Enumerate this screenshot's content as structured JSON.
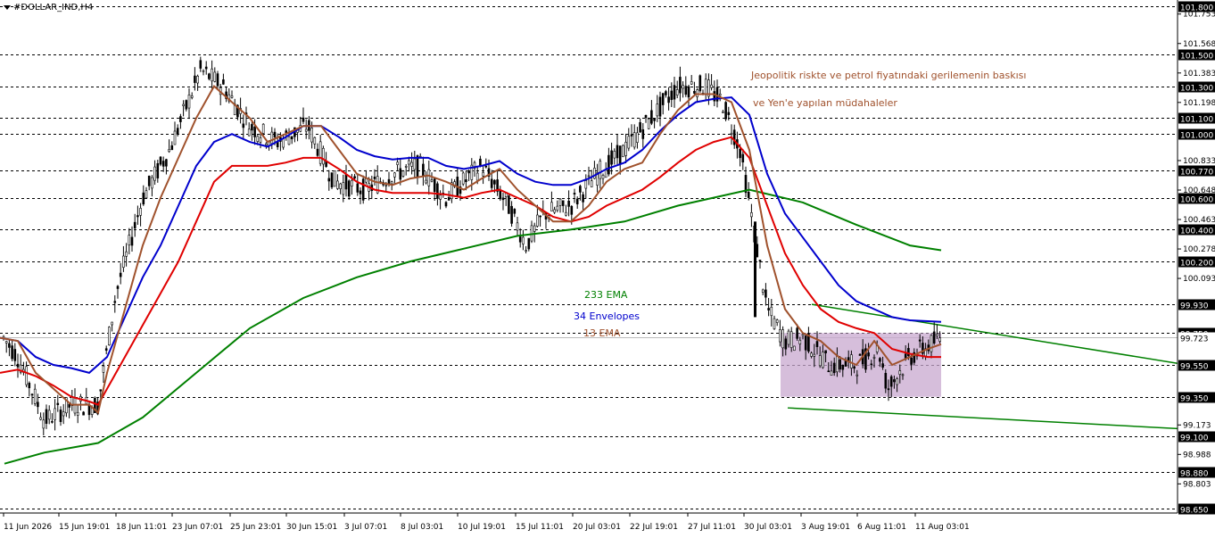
{
  "chart_data": {
    "type": "candlestick",
    "symbol": "#DOLLAR_IND,H4",
    "ylim": [
      98.62,
      101.83
    ],
    "y_ticks": [
      "101.753",
      "101.568",
      "101.383",
      "101.198",
      "100.833",
      "100.648",
      "100.463",
      "100.278",
      "100.093",
      "99.173",
      "98.988",
      "98.803"
    ],
    "level_lines": [
      {
        "value": 101.8,
        "label": "101.800"
      },
      {
        "value": 101.5,
        "label": "101.500"
      },
      {
        "value": 101.3,
        "label": "101.300"
      },
      {
        "value": 101.1,
        "label": "101.100"
      },
      {
        "value": 101.0,
        "label": "101.000"
      },
      {
        "value": 100.77,
        "label": "100.770"
      },
      {
        "value": 100.6,
        "label": "100.600"
      },
      {
        "value": 100.4,
        "label": "100.400"
      },
      {
        "value": 100.2,
        "label": "100.200"
      },
      {
        "value": 99.93,
        "label": "99.930"
      },
      {
        "value": 99.75,
        "label": "99.750"
      },
      {
        "value": 99.55,
        "label": "99.550"
      },
      {
        "value": 99.35,
        "label": "99.350"
      },
      {
        "value": 99.1,
        "label": "99.100"
      },
      {
        "value": 98.88,
        "label": "98.880"
      },
      {
        "value": 98.65,
        "label": "98.650"
      }
    ],
    "current_price": {
      "value": 99.723,
      "label": "99.723"
    },
    "x_ticks": [
      "11 Jun 2026",
      "15 Jun 19:01",
      "18 Jun 11:01",
      "23 Jun 07:01",
      "25 Jun 23:01",
      "30 Jun 15:01",
      "3 Jul 07:01",
      "8 Jul 03:01",
      "10 Jul 19:01",
      "15 Jul 11:01",
      "20 Jul 03:01",
      "22 Jul 19:01",
      "27 Jul 11:01",
      "30 Jul 03:01",
      "3 Aug 19:01",
      "6 Aug 11:01",
      "11 Aug 03:01"
    ],
    "indicators": [
      {
        "name": "233 EMA",
        "color": "#008000"
      },
      {
        "name": "34 Envelopes",
        "color": "#0000cd"
      },
      {
        "name": "13 EMA",
        "color": "#a0522d"
      }
    ],
    "ema_13_path": [
      [
        0,
        99.72
      ],
      [
        20,
        99.7
      ],
      [
        40,
        99.5
      ],
      [
        60,
        99.4
      ],
      [
        80,
        99.3
      ],
      [
        100,
        99.3
      ],
      [
        110,
        99.25
      ],
      [
        120,
        99.5
      ],
      [
        140,
        99.9
      ],
      [
        160,
        100.3
      ],
      [
        180,
        100.6
      ],
      [
        200,
        100.85
      ],
      [
        220,
        101.1
      ],
      [
        240,
        101.3
      ],
      [
        260,
        101.2
      ],
      [
        280,
        101.1
      ],
      [
        300,
        100.95
      ],
      [
        320,
        101.0
      ],
      [
        340,
        101.05
      ],
      [
        360,
        101.05
      ],
      [
        380,
        100.9
      ],
      [
        400,
        100.75
      ],
      [
        420,
        100.7
      ],
      [
        440,
        100.68
      ],
      [
        460,
        100.72
      ],
      [
        480,
        100.74
      ],
      [
        500,
        100.7
      ],
      [
        520,
        100.65
      ],
      [
        540,
        100.72
      ],
      [
        560,
        100.78
      ],
      [
        580,
        100.65
      ],
      [
        600,
        100.55
      ],
      [
        620,
        100.45
      ],
      [
        640,
        100.45
      ],
      [
        660,
        100.55
      ],
      [
        680,
        100.7
      ],
      [
        700,
        100.78
      ],
      [
        720,
        100.82
      ],
      [
        740,
        101.0
      ],
      [
        760,
        101.15
      ],
      [
        780,
        101.25
      ],
      [
        800,
        101.25
      ],
      [
        820,
        101.2
      ],
      [
        840,
        100.9
      ],
      [
        860,
        100.3
      ],
      [
        880,
        99.9
      ],
      [
        900,
        99.75
      ],
      [
        920,
        99.7
      ],
      [
        940,
        99.6
      ],
      [
        960,
        99.55
      ],
      [
        980,
        99.7
      ],
      [
        1000,
        99.55
      ],
      [
        1020,
        99.6
      ],
      [
        1040,
        99.65
      ],
      [
        1055,
        99.68
      ]
    ],
    "envelope_path": [
      [
        0,
        99.72
      ],
      [
        20,
        99.7
      ],
      [
        40,
        99.6
      ],
      [
        60,
        99.55
      ],
      [
        80,
        99.53
      ],
      [
        100,
        99.5
      ],
      [
        120,
        99.6
      ],
      [
        140,
        99.85
      ],
      [
        160,
        100.1
      ],
      [
        180,
        100.3
      ],
      [
        200,
        100.55
      ],
      [
        220,
        100.8
      ],
      [
        240,
        100.95
      ],
      [
        260,
        101.0
      ],
      [
        280,
        100.95
      ],
      [
        300,
        100.92
      ],
      [
        320,
        100.98
      ],
      [
        340,
        101.05
      ],
      [
        360,
        101.05
      ],
      [
        380,
        100.98
      ],
      [
        400,
        100.9
      ],
      [
        420,
        100.86
      ],
      [
        440,
        100.84
      ],
      [
        460,
        100.85
      ],
      [
        480,
        100.85
      ],
      [
        500,
        100.8
      ],
      [
        520,
        100.78
      ],
      [
        540,
        100.8
      ],
      [
        560,
        100.83
      ],
      [
        580,
        100.75
      ],
      [
        600,
        100.7
      ],
      [
        620,
        100.68
      ],
      [
        640,
        100.68
      ],
      [
        660,
        100.72
      ],
      [
        680,
        100.78
      ],
      [
        700,
        100.82
      ],
      [
        720,
        100.9
      ],
      [
        740,
        101.02
      ],
      [
        760,
        101.12
      ],
      [
        780,
        101.2
      ],
      [
        800,
        101.22
      ],
      [
        820,
        101.23
      ],
      [
        840,
        101.12
      ],
      [
        860,
        100.75
      ],
      [
        880,
        100.5
      ],
      [
        900,
        100.35
      ],
      [
        920,
        100.2
      ],
      [
        940,
        100.05
      ],
      [
        960,
        99.95
      ],
      [
        980,
        99.9
      ],
      [
        1000,
        99.85
      ],
      [
        1020,
        99.83
      ],
      [
        1055,
        99.82
      ]
    ],
    "red_line_path": [
      [
        0,
        99.5
      ],
      [
        20,
        99.52
      ],
      [
        40,
        99.48
      ],
      [
        60,
        99.42
      ],
      [
        80,
        99.35
      ],
      [
        100,
        99.32
      ],
      [
        110,
        99.3
      ],
      [
        120,
        99.4
      ],
      [
        140,
        99.6
      ],
      [
        160,
        99.8
      ],
      [
        180,
        100.0
      ],
      [
        200,
        100.2
      ],
      [
        220,
        100.45
      ],
      [
        240,
        100.7
      ],
      [
        260,
        100.8
      ],
      [
        280,
        100.8
      ],
      [
        300,
        100.8
      ],
      [
        320,
        100.82
      ],
      [
        340,
        100.85
      ],
      [
        360,
        100.85
      ],
      [
        380,
        100.78
      ],
      [
        400,
        100.7
      ],
      [
        420,
        100.65
      ],
      [
        440,
        100.63
      ],
      [
        460,
        100.63
      ],
      [
        480,
        100.63
      ],
      [
        500,
        100.62
      ],
      [
        520,
        100.6
      ],
      [
        540,
        100.63
      ],
      [
        560,
        100.65
      ],
      [
        580,
        100.6
      ],
      [
        600,
        100.55
      ],
      [
        620,
        100.48
      ],
      [
        640,
        100.45
      ],
      [
        660,
        100.48
      ],
      [
        680,
        100.55
      ],
      [
        700,
        100.6
      ],
      [
        720,
        100.65
      ],
      [
        740,
        100.73
      ],
      [
        760,
        100.82
      ],
      [
        780,
        100.9
      ],
      [
        800,
        100.95
      ],
      [
        820,
        100.98
      ],
      [
        840,
        100.85
      ],
      [
        860,
        100.55
      ],
      [
        880,
        100.25
      ],
      [
        900,
        100.05
      ],
      [
        920,
        99.9
      ],
      [
        940,
        99.82
      ],
      [
        960,
        99.78
      ],
      [
        980,
        99.75
      ],
      [
        1000,
        99.65
      ],
      [
        1020,
        99.62
      ],
      [
        1040,
        99.6
      ],
      [
        1055,
        99.6
      ]
    ],
    "ema_233_path": [
      [
        5,
        98.93
      ],
      [
        50,
        99.0
      ],
      [
        110,
        99.06
      ],
      [
        160,
        99.22
      ],
      [
        220,
        99.5
      ],
      [
        280,
        99.78
      ],
      [
        340,
        99.97
      ],
      [
        400,
        100.1
      ],
      [
        460,
        100.2
      ],
      [
        520,
        100.28
      ],
      [
        580,
        100.36
      ],
      [
        640,
        100.4
      ],
      [
        700,
        100.45
      ],
      [
        760,
        100.55
      ],
      [
        840,
        100.65
      ],
      [
        900,
        100.57
      ],
      [
        960,
        100.43
      ],
      [
        1020,
        100.3
      ],
      [
        1055,
        100.27
      ]
    ],
    "candle_range": [
      [
        0,
        99.75
      ],
      [
        20,
        99.6
      ],
      [
        50,
        99.2
      ],
      [
        80,
        99.3
      ],
      [
        110,
        99.3
      ],
      [
        130,
        100.0
      ],
      [
        160,
        100.6
      ],
      [
        190,
        100.9
      ],
      [
        225,
        101.4
      ],
      [
        250,
        101.3
      ],
      [
        280,
        101.05
      ],
      [
        310,
        100.95
      ],
      [
        345,
        101.05
      ],
      [
        375,
        100.7
      ],
      [
        410,
        100.65
      ],
      [
        440,
        100.75
      ],
      [
        470,
        100.8
      ],
      [
        500,
        100.6
      ],
      [
        540,
        100.8
      ],
      [
        570,
        100.55
      ],
      [
        590,
        100.3
      ],
      [
        610,
        100.5
      ],
      [
        640,
        100.55
      ],
      [
        670,
        100.75
      ],
      [
        700,
        100.9
      ],
      [
        730,
        101.1
      ],
      [
        760,
        101.3
      ],
      [
        790,
        101.3
      ],
      [
        810,
        101.2
      ],
      [
        830,
        100.9
      ],
      [
        845,
        100.4
      ],
      [
        860,
        99.9
      ],
      [
        880,
        99.7
      ],
      [
        900,
        99.72
      ],
      [
        930,
        99.55
      ],
      [
        960,
        99.55
      ],
      [
        985,
        99.65
      ],
      [
        995,
        99.4
      ],
      [
        1020,
        99.6
      ],
      [
        1055,
        99.72
      ]
    ],
    "annotations": {
      "line1": "Jeopolitik riskte ve petrol fiyatındaki gerilemenin baskısı",
      "line2": "ve Yen'e yapılan müdahaleler"
    },
    "colors": {
      "level_line": "#000000",
      "ema_233": "#008000",
      "envelope": "#0000cd",
      "ema_13": "#a0522d",
      "red": "#e00000",
      "box_fill": "#c8a8cf",
      "trend": "#008000",
      "annotation": "#a0522d"
    }
  }
}
